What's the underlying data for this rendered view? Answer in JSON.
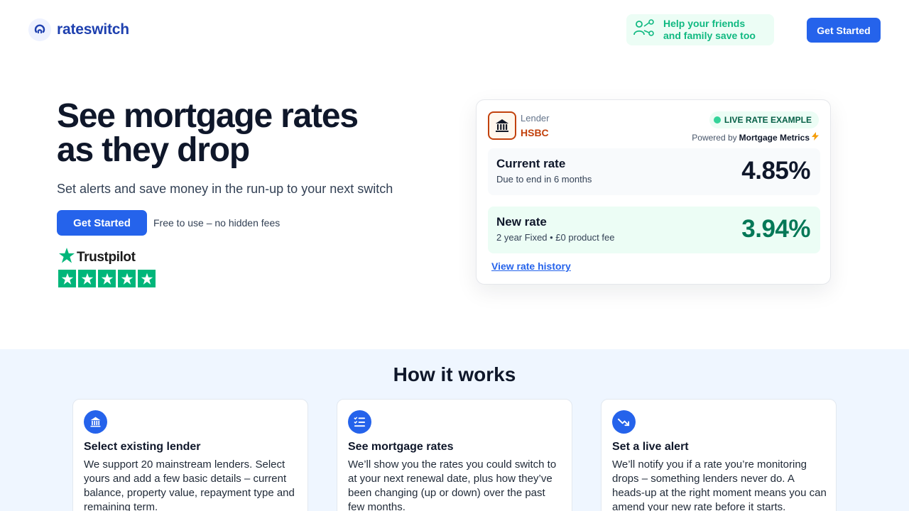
{
  "header": {
    "logo_text": "rateswitch",
    "share_line1": "Help your friends",
    "share_line2": "and family save too",
    "cta_label": "Get Started"
  },
  "hero": {
    "title_line1": "See mortgage rates",
    "title_line2": "as they drop",
    "subtitle": "Set alerts and save money in the run-up to your next switch",
    "cta_label": "Get Started",
    "note": "Free to use – no hidden fees",
    "trustpilot_label": "Trustpilot",
    "trustpilot_rating_stars": 5
  },
  "rate_card": {
    "lender_label": "Lender",
    "lender_name": "HSBC",
    "badge": "LIVE RATE EXAMPLE",
    "powered_prefix": "Powered by",
    "powered_brand": "Mortgage Metrics",
    "current": {
      "title": "Current rate",
      "desc": "Due to end in 6 months",
      "value": "4.85%"
    },
    "new": {
      "title": "New rate",
      "desc": "2 year Fixed • £0 product fee",
      "value": "3.94%"
    },
    "history_link": "View rate history"
  },
  "how_it_works": {
    "title": "How it works",
    "steps": [
      {
        "icon": "bank-icon",
        "title": "Select existing lender",
        "body": "We support 20 mainstream lenders. Select yours and add a few basic details – current balance, property value, repayment type and remaining term."
      },
      {
        "icon": "list-check-icon",
        "title": "See mortgage rates",
        "body": "We’ll show you the rates you could switch to at your next renewal date, plus how they’ve been changing (up or down) over the past few months."
      },
      {
        "icon": "trend-down-icon",
        "title": "Set a live alert",
        "body": "We’ll notify you if a rate you’re monitoring drops – something lenders never do. A heads-up at the right moment means you can amend your new rate before it starts."
      }
    ]
  },
  "colors": {
    "brand_blue": "#2563eb",
    "logo_blue": "#1e40af",
    "green_accent": "#10b981",
    "lender_orange": "#c2410c",
    "new_rate_green": "#047857",
    "section_bg": "#eff6ff",
    "trustpilot_green": "#00b67a"
  }
}
